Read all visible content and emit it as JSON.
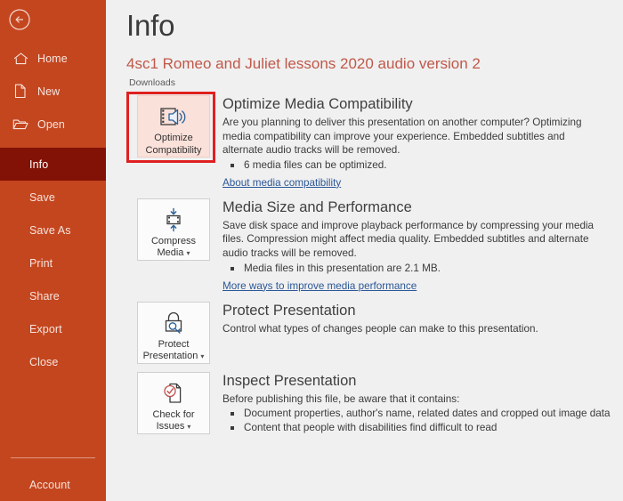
{
  "sidebar": {
    "back_label": "back-arrow",
    "top_items": [
      {
        "label": "Home",
        "icon": "home-icon"
      },
      {
        "label": "New",
        "icon": "new-document-icon"
      },
      {
        "label": "Open",
        "icon": "open-folder-icon"
      }
    ],
    "items": [
      {
        "label": "Info",
        "active": true
      },
      {
        "label": "Save",
        "active": false
      },
      {
        "label": "Save As",
        "active": false
      },
      {
        "label": "Print",
        "active": false
      },
      {
        "label": "Share",
        "active": false
      },
      {
        "label": "Export",
        "active": false
      },
      {
        "label": "Close",
        "active": false
      }
    ],
    "bottom_items": [
      {
        "label": "Account"
      }
    ],
    "colors": {
      "background": "#c4461f",
      "active_background": "#821205",
      "text": "#f7e4dd"
    }
  },
  "main": {
    "page_title": "Info",
    "document_title": "4sc1 Romeo and Juliet lessons 2020 audio version 2",
    "document_path": "Downloads",
    "title_color": "#c0584a",
    "highlight_color": "#e02020",
    "sections": [
      {
        "button": {
          "caption_line1": "Optimize",
          "caption_line2": "Compatibility",
          "icon": "film-speaker-icon",
          "has_caret": false,
          "highlighted": true
        },
        "title": "Optimize Media Compatibility",
        "description": "Are you planning to deliver this presentation on another computer? Optimizing media compatibility can improve your experience. Embedded subtitles and alternate audio tracks will be removed.",
        "bullets": [
          "6 media files can be optimized."
        ],
        "link": "About media compatibility"
      },
      {
        "button": {
          "caption_line1": "Compress",
          "caption_line2": "Media",
          "icon": "film-compress-icon",
          "has_caret": true,
          "highlighted": false
        },
        "title": "Media Size and Performance",
        "description": "Save disk space and improve playback performance by compressing your media files. Compression might affect media quality. Embedded subtitles and alternate audio tracks will be removed.",
        "bullets": [
          "Media files in this presentation are 2.1 MB."
        ],
        "link": "More ways to improve media performance"
      },
      {
        "button": {
          "caption_line1": "Protect",
          "caption_line2": "Presentation",
          "icon": "lock-key-icon",
          "has_caret": true,
          "highlighted": false
        },
        "title": "Protect Presentation",
        "description": "Control what types of changes people can make to this presentation.",
        "bullets": [],
        "link": ""
      },
      {
        "button": {
          "caption_line1": "Check for",
          "caption_line2": "Issues",
          "icon": "document-check-icon",
          "has_caret": true,
          "highlighted": false
        },
        "title": "Inspect Presentation",
        "description": "Before publishing this file, be aware that it contains:",
        "bullets": [
          "Document properties, author's name, related dates and cropped out image data",
          "Content that people with disabilities find difficult to read"
        ],
        "link": ""
      }
    ]
  }
}
